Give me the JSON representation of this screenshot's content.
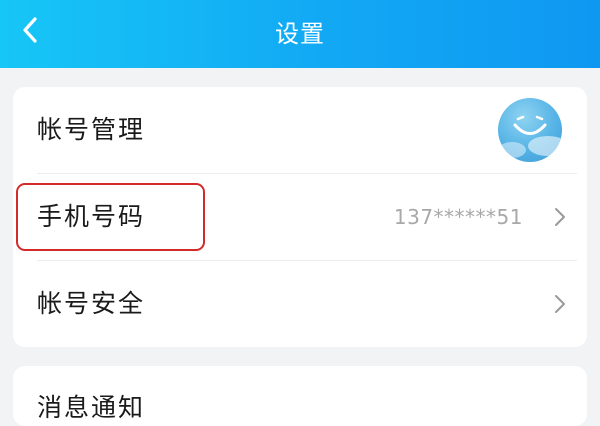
{
  "header": {
    "title": "设置",
    "back_icon": "chevron-left-icon"
  },
  "settings": {
    "account_management": {
      "label": "帐号管理",
      "avatar_icon": "avatar"
    },
    "phone_number": {
      "label": "手机号码",
      "value": "137******51",
      "chevron_icon": "chevron-right-icon",
      "highlighted": true
    },
    "account_security": {
      "label": "帐号安全",
      "chevron_icon": "chevron-right-icon"
    }
  },
  "next_section": {
    "label": "消息通知"
  },
  "colors": {
    "header_gradient_start": "#16c6f6",
    "header_gradient_end": "#0f98f2",
    "background": "#f2f3f5",
    "card": "#ffffff",
    "highlight": "#d42a2a",
    "secondary_text": "#a8a8a8"
  }
}
